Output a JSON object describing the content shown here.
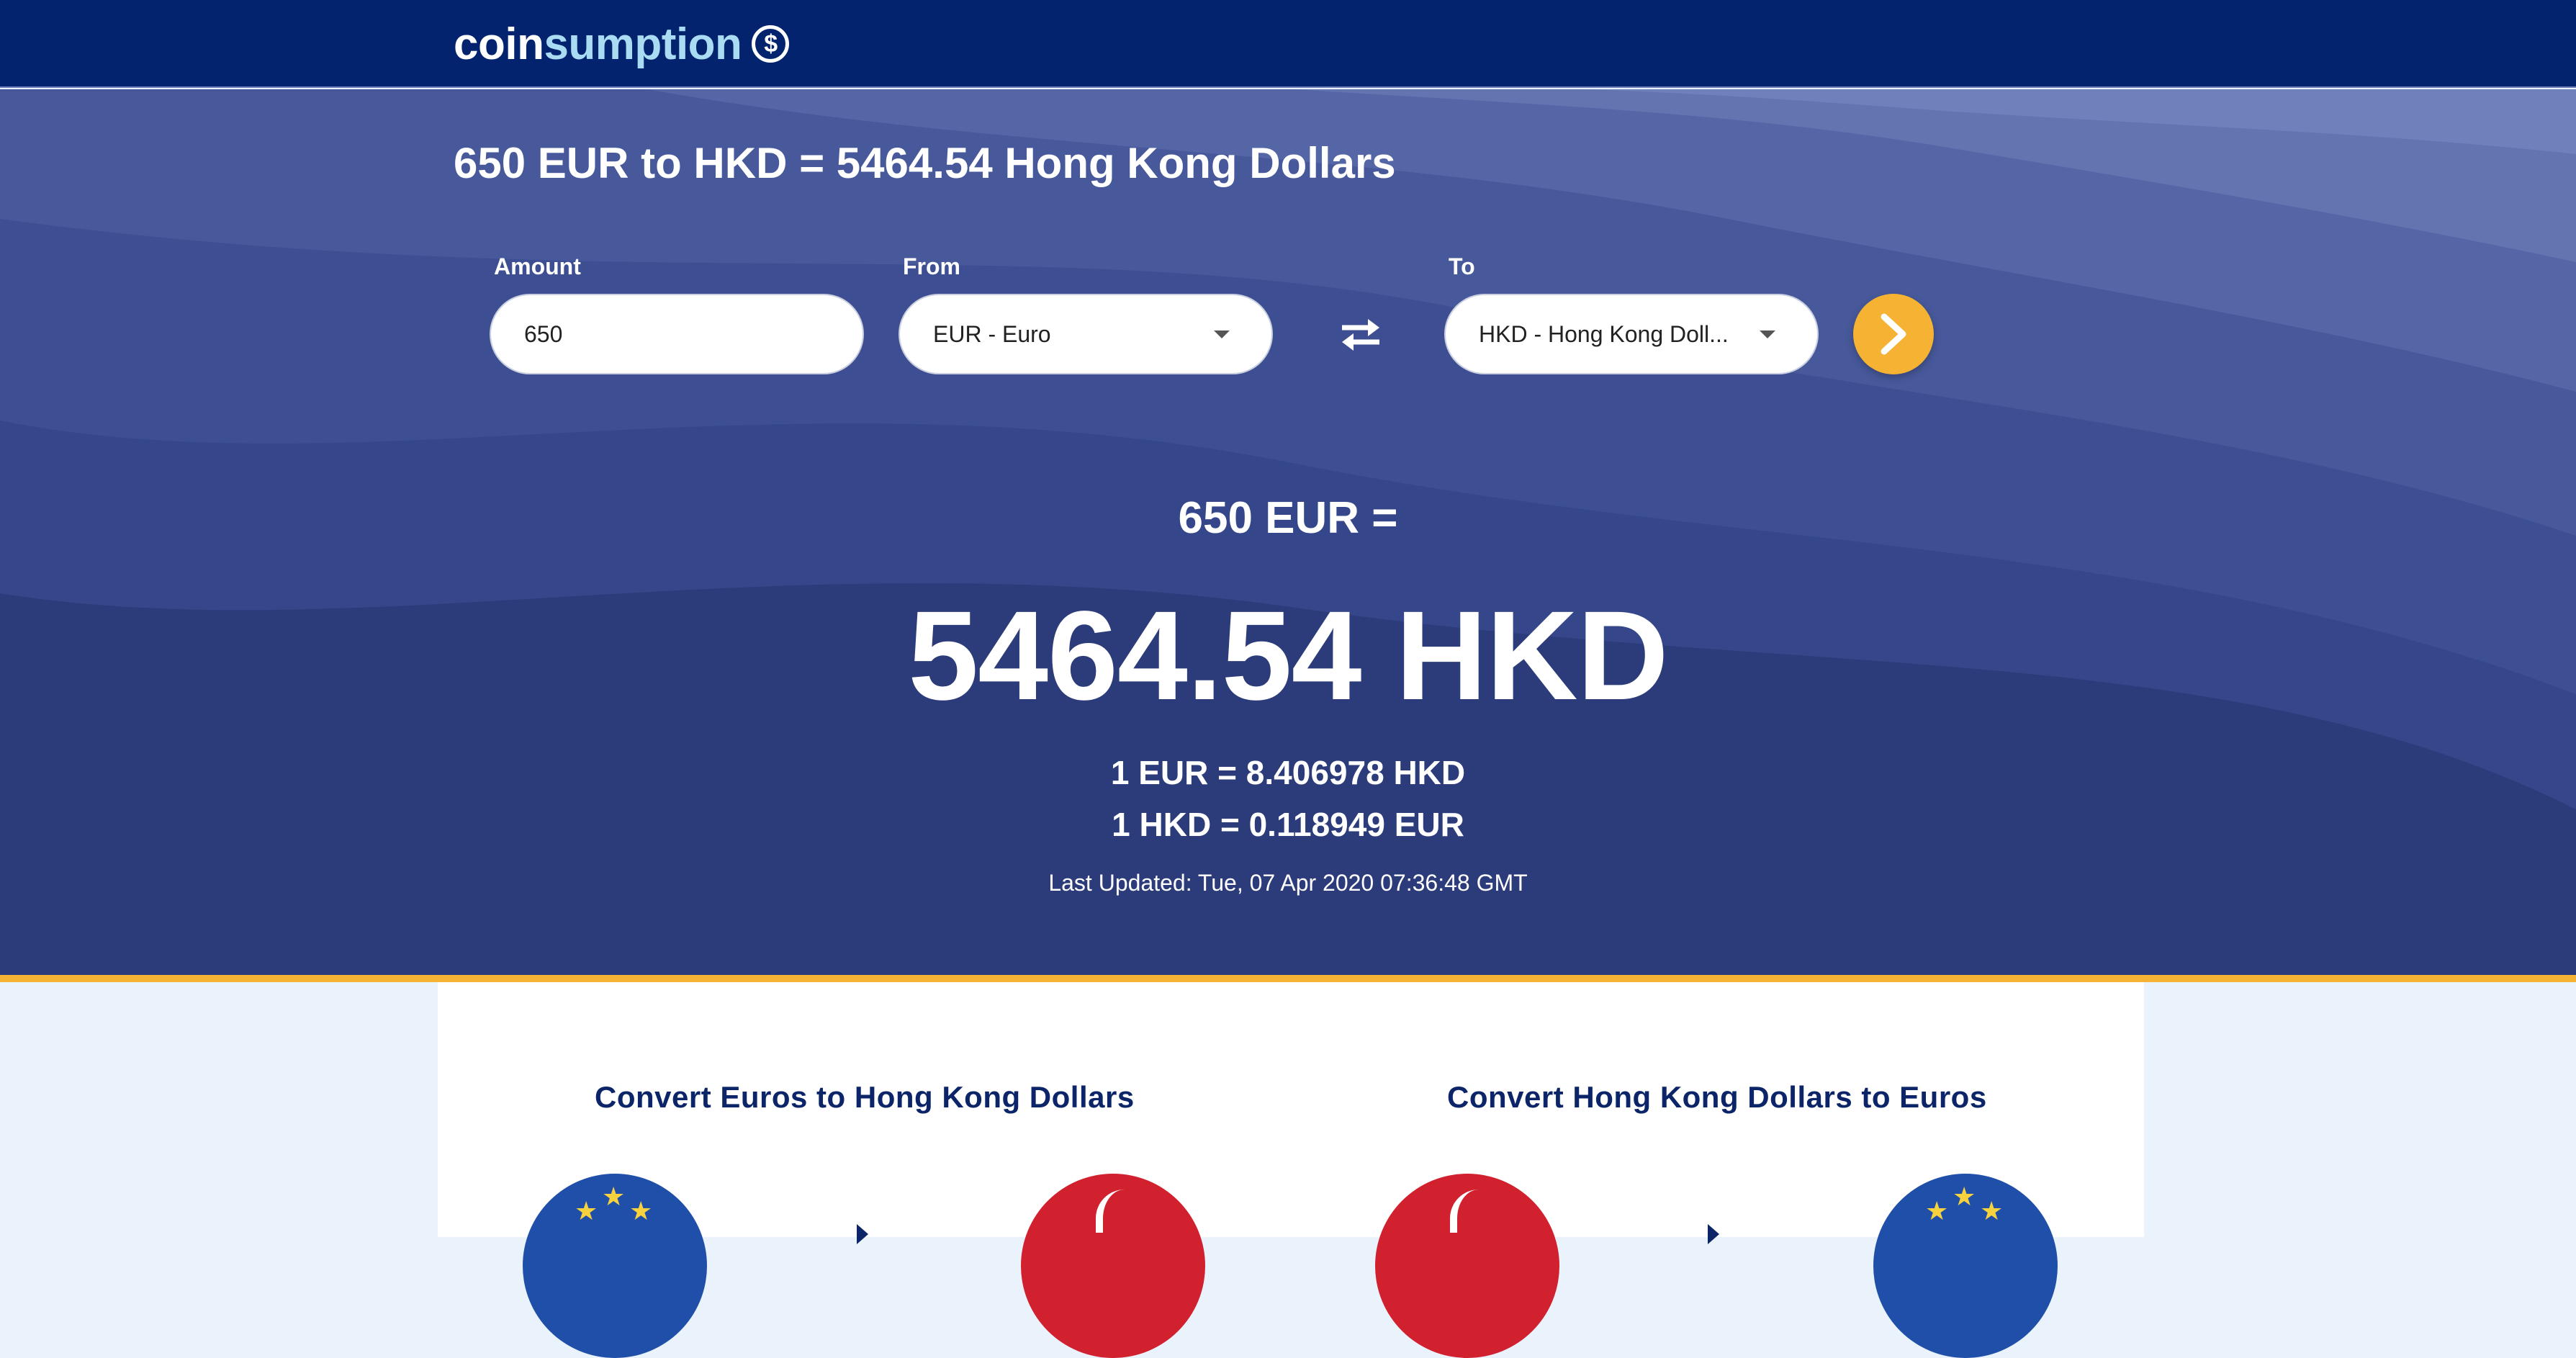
{
  "brand": {
    "part1": "coin",
    "part2": "sumption",
    "icon": "dollar-coin-icon"
  },
  "heading": "650 EUR to HKD = 5464.54 Hong Kong Dollars",
  "form": {
    "amount_label": "Amount",
    "amount_value": "650",
    "from_label": "From",
    "from_value": "EUR - Euro",
    "to_label": "To",
    "to_value": "HKD - Hong Kong Doll...",
    "swap_icon": "swap-arrows-icon",
    "submit_icon": "chevron-right-icon"
  },
  "result": {
    "from_text": "650 EUR =",
    "to_text": "5464.54 HKD",
    "rate_forward": "1 EUR = 8.406978 HKD",
    "rate_reverse": "1 HKD = 0.118949 EUR",
    "last_updated": "Last Updated: Tue, 07 Apr 2020 07:36:48 GMT"
  },
  "cards": [
    {
      "title": "Convert Euros to Hong Kong Dollars"
    },
    {
      "title": "Convert Hong Kong Dollars to Euros"
    }
  ],
  "colors": {
    "nav": "#03236f",
    "hero": "#2e3f7e",
    "accent": "#f5b233",
    "card_title": "#0b2568"
  }
}
